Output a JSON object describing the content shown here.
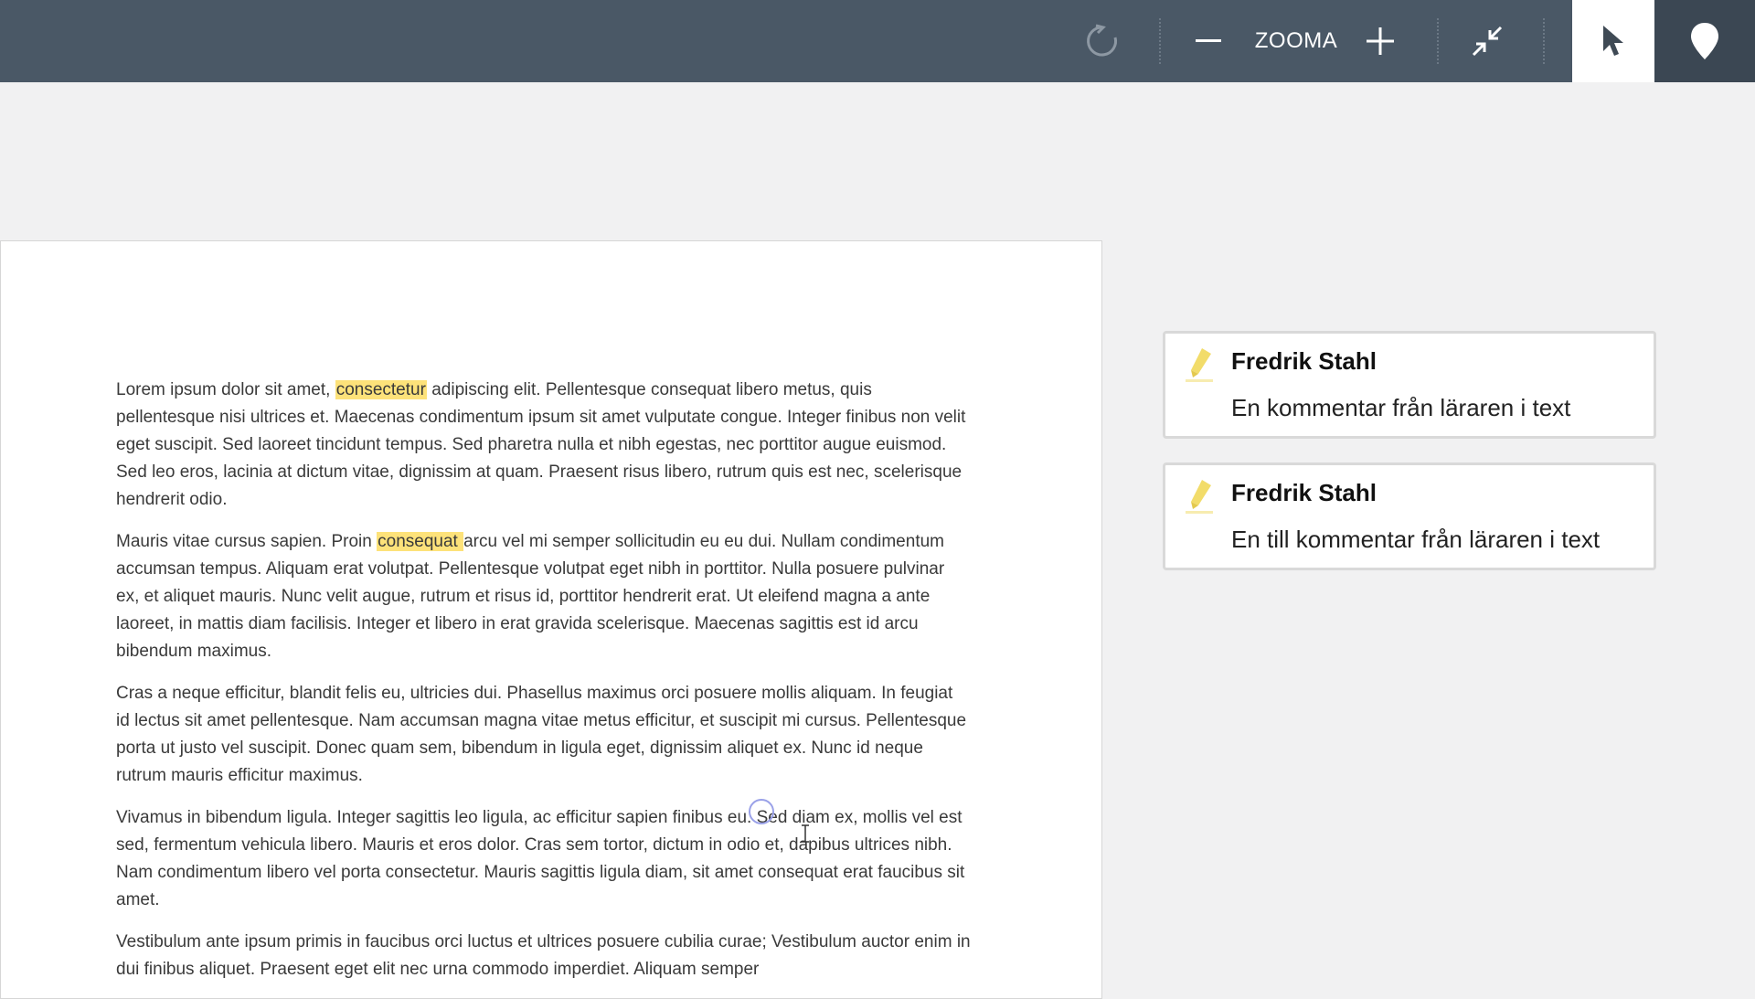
{
  "toolbar": {
    "zoom_label": "ZOOMA",
    "icons": [
      "rotate-icon",
      "zoom-out-icon",
      "zoom-in-icon",
      "collapse-icon",
      "pointer-icon",
      "pin-icon"
    ]
  },
  "document": {
    "paragraphs": [
      {
        "before": "Lorem ipsum dolor sit amet, ",
        "highlight": "consectetur",
        "after": " adipiscing elit. Pellentesque consequat libero metus, quis pellentesque nisi ultrices et. Maecenas condimentum ipsum sit amet vulputate congue. Integer finibus non velit eget suscipit. Sed laoreet tincidunt tempus. Sed pharetra nulla et nibh egestas, nec porttitor augue euismod. Sed leo eros, lacinia at dictum vitae, dignissim at quam. Praesent risus libero, rutrum quis est nec, scelerisque hendrerit odio."
      },
      {
        "before": "Mauris vitae cursus sapien. Proin ",
        "highlight": "consequat ",
        "after": "arcu vel mi semper sollicitudin eu eu dui. Nullam condimentum accumsan tempus. Aliquam erat volutpat. Pellentesque volutpat eget nibh in porttitor. Nulla posuere pulvinar ex, et aliquet mauris. Nunc velit augue, rutrum et risus id, porttitor hendrerit erat. Ut eleifend magna a ante laoreet, in mattis diam facilisis. Integer et libero in erat gravida scelerisque. Maecenas sagittis est id arcu bibendum maximus."
      },
      {
        "text": "Cras a neque efficitur, blandit felis eu, ultricies dui. Phasellus maximus orci posuere mollis aliquam. In feugiat id lectus sit amet pellentesque. Nam accumsan magna vitae metus efficitur, et suscipit mi cursus. Pellentesque porta ut justo vel suscipit. Donec quam sem, bibendum in ligula eget, dignissim aliquet ex. Nunc id neque rutrum mauris efficitur maximus."
      },
      {
        "text": "Vivamus in bibendum ligula. Integer sagittis leo ligula, ac efficitur sapien finibus eu. Sed diam ex, mollis vel est sed, fermentum vehicula libero. Mauris et eros dolor. Cras sem tortor, dictum in odio et, dapibus ultrices nibh. Nam condimentum libero vel porta consectetur. Mauris sagittis ligula diam, sit amet consequat erat faucibus sit amet."
      },
      {
        "text": "Vestibulum ante ipsum primis in faucibus orci luctus et ultrices posuere cubilia curae; Vestibulum auctor enim in dui finibus aliquet. Praesent eget elit nec urna commodo imperdiet. Aliquam semper"
      }
    ]
  },
  "comments": [
    {
      "author": "Fredrik Stahl",
      "text": "En kommentar från läraren i text",
      "icon": "highlighter-icon"
    },
    {
      "author": "Fredrik Stahl",
      "text": "En till kommentar från läraren i text",
      "icon": "highlighter-icon"
    }
  ],
  "colors": {
    "toolbar_bg": "#4a5866",
    "highlight": "#fde27a",
    "highlighter_icon": "#f2dc6a"
  }
}
